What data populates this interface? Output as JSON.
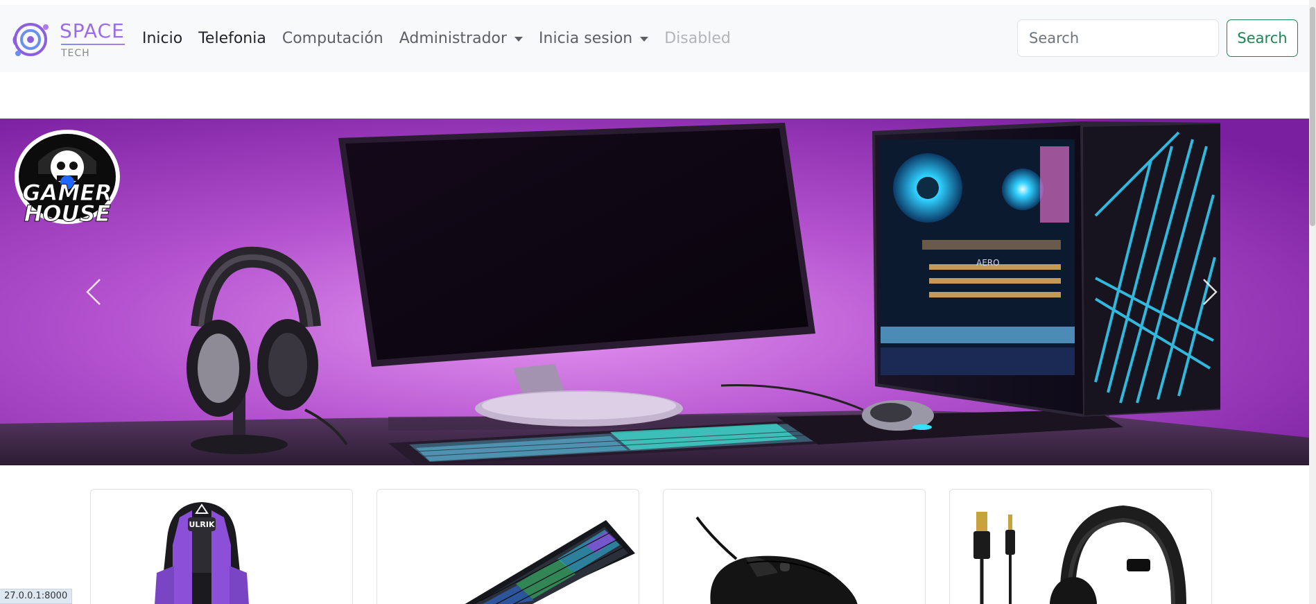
{
  "brand": {
    "name_top": "SPACE",
    "name_bottom": "TECH"
  },
  "nav": {
    "items": [
      {
        "label": "Inicio"
      },
      {
        "label": "Telefonia"
      },
      {
        "label": "Computación"
      },
      {
        "label": "Administrador"
      },
      {
        "label": "Inicia sesion"
      },
      {
        "label": "Disabled"
      }
    ]
  },
  "search": {
    "placeholder": "Search",
    "value": "",
    "button_label": "Search"
  },
  "carousel": {
    "logo_line1": "GAMER",
    "logo_line2": "HOUSE",
    "case_label": "AERO",
    "accent_color": "#a33fc4"
  },
  "cards": [
    {
      "name": "gaming-chair",
      "chair_label": "ULRIK"
    },
    {
      "name": "rgb-keyboard"
    },
    {
      "name": "gaming-mouse"
    },
    {
      "name": "gaming-headset"
    }
  ],
  "status_bar": {
    "url": "27.0.0.1:8000"
  },
  "colors": {
    "search_green": "#198754",
    "navbar_bg": "#f8f9fa",
    "brand_purple": "#9b6ce8"
  }
}
